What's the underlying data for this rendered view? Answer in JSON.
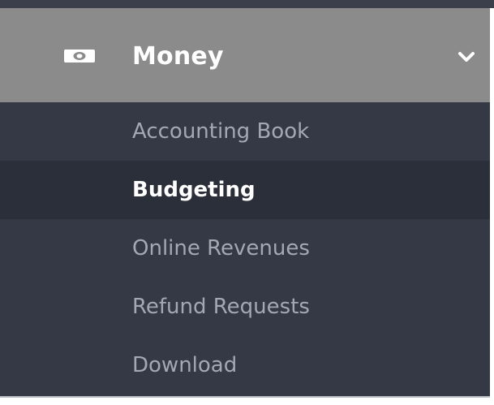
{
  "menu": {
    "title": "Money",
    "icon": "money-bill-icon",
    "expanded": true,
    "items": [
      {
        "label": "Accounting Book",
        "active": false
      },
      {
        "label": "Budgeting",
        "active": true
      },
      {
        "label": "Online Revenues",
        "active": false
      },
      {
        "label": "Refund Requests",
        "active": false
      },
      {
        "label": "Download",
        "active": false
      }
    ]
  },
  "colors": {
    "header_bg": "#8b8b8b",
    "submenu_bg": "#343945",
    "active_bg": "#2b2f39",
    "inactive_text": "#a4a8b2",
    "active_text": "#ffffff"
  }
}
